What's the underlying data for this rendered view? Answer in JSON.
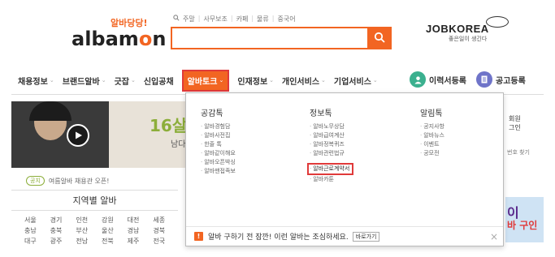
{
  "header": {
    "logo_tagline": "알바당당!",
    "logo_prefix": "albam",
    "logo_o": "o",
    "logo_suffix": "n",
    "search_tags": [
      "주말",
      "사무보조",
      "카페",
      "물류",
      "중국어"
    ],
    "search_placeholder": "",
    "jobkorea_name": "JOBKOREA",
    "jobkorea_tagline": "좋은일이 생긴다"
  },
  "nav": {
    "items": [
      {
        "label": "채용정보",
        "chevron": true
      },
      {
        "label": "브랜드알바",
        "chevron": true
      },
      {
        "label": "긋잡",
        "chevron": true
      },
      {
        "label": "신입공채",
        "chevron": false
      },
      {
        "label": "알바토크",
        "chevron": true,
        "active": true
      },
      {
        "label": "인재정보",
        "chevron": true
      },
      {
        "label": "개인서비스",
        "chevron": true
      },
      {
        "label": "기업서비스",
        "chevron": true
      }
    ],
    "resume_label": "이력서등록",
    "post_label": "공고등록",
    "accent": "#f26522"
  },
  "dropdown": {
    "col1": {
      "title": "공감톡",
      "items": [
        "알바경험담",
        "알바사전집",
        "한줄 톡",
        "알바같이해요",
        "알바오픈박싱",
        "알바맨접족보"
      ]
    },
    "col2": {
      "title": "정보톡",
      "items": [
        "알바노무상담",
        "알바급여계산",
        "알바정복퀴즈",
        "알바관련법규",
        "알바근로계약서",
        "알바카툰"
      ],
      "highlight_index": 4
    },
    "col3": {
      "title": "알림톡",
      "items": [
        "공지사항",
        "알바뉴스",
        "이벤트",
        "공모전"
      ]
    },
    "footer_text": "알바 구하기 전 잠깐! 이런 알바는 조심하세요.",
    "footer_button": "바로가기",
    "footer_close": "×",
    "warn_mark": "!"
  },
  "banner": {
    "title": "16살이",
    "sub": "남다른"
  },
  "notice": {
    "badge": "공지",
    "text": "여름알바 채용관 오픈!"
  },
  "region": {
    "title": "지역별 알바",
    "items": [
      "서울",
      "경기",
      "인천",
      "강원",
      "대전",
      "세종",
      "충남",
      "충북",
      "부산",
      "울산",
      "경남",
      "경북",
      "대구",
      "광주",
      "전남",
      "전북",
      "제주",
      "전국"
    ]
  },
  "right_col": {
    "line1": "회원",
    "line2": "그인",
    "line3": "번호 찾기",
    "banner_line1": "이",
    "banner_line2": "바 구인"
  }
}
